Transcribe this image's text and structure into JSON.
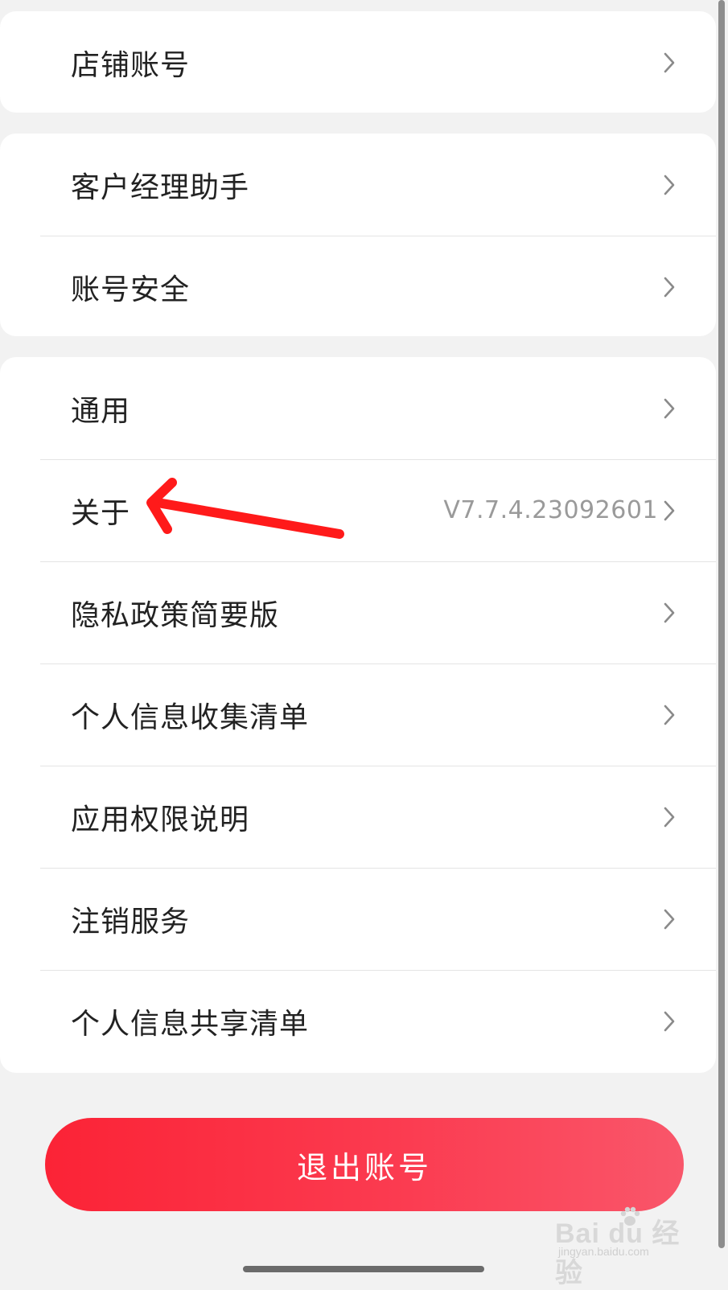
{
  "groups": [
    {
      "items": [
        {
          "label": "店铺账号",
          "value": ""
        }
      ]
    },
    {
      "items": [
        {
          "label": "客户经理助手",
          "value": ""
        },
        {
          "label": "账号安全",
          "value": ""
        }
      ]
    },
    {
      "items": [
        {
          "label": "通用",
          "value": ""
        },
        {
          "label": "关于",
          "value": "V7.7.4.23092601"
        },
        {
          "label": "隐私政策简要版",
          "value": ""
        },
        {
          "label": "个人信息收集清单",
          "value": ""
        },
        {
          "label": "应用权限说明",
          "value": ""
        },
        {
          "label": "注销服务",
          "value": ""
        },
        {
          "label": "个人信息共享清单",
          "value": ""
        }
      ]
    }
  ],
  "logout_label": "退出账号",
  "watermark": {
    "brand": "Bai du 经验",
    "site": "jingyan.baidu.com"
  },
  "colors": {
    "accent": "#fb2336",
    "annotation_arrow": "#ff1a1a",
    "background": "#f2f2f2"
  },
  "icons": {
    "row_chevron": "chevron-right-icon"
  }
}
